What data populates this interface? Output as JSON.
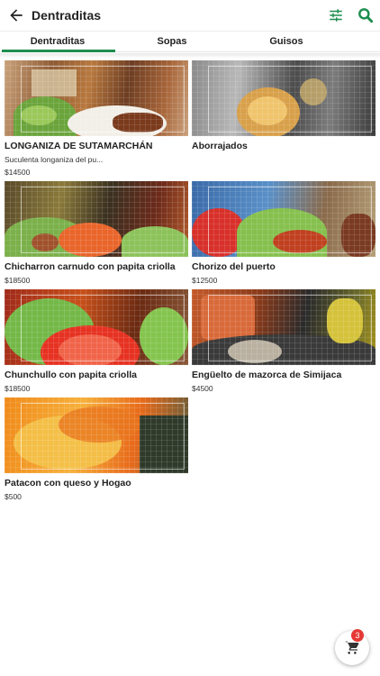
{
  "appbar": {
    "title": "Dentraditas"
  },
  "tabs": [
    {
      "label": "Dentraditas",
      "active": true
    },
    {
      "label": "Sopas",
      "active": false
    },
    {
      "label": "Guisos",
      "active": false
    }
  ],
  "colors": {
    "accent": "#1e8e4e",
    "badge": "#e53935"
  },
  "icons": {
    "back": "arrow-back-icon",
    "filter": "tune-icon",
    "search": "search-icon",
    "cart": "cart-icon"
  },
  "products": [
    {
      "name": "LONGANIZA DE SUTAMARCHÁN",
      "description": "Suculenta longaniza del pu...",
      "price": "$14500"
    },
    {
      "name": "Aborrajados",
      "description": "",
      "price": ""
    },
    {
      "name": "Chicharron carnudo con papita criolla",
      "description": "",
      "price": "$18500"
    },
    {
      "name": "Chorizo del puerto",
      "description": "",
      "price": "$12500"
    },
    {
      "name": "Chunchullo con papita criolla",
      "description": "",
      "price": "$18500"
    },
    {
      "name": "Engüelto de mazorca de Simijaca",
      "description": "",
      "price": "$4500"
    },
    {
      "name": "Patacon con queso y Hogao",
      "description": "",
      "price": "$500"
    }
  ],
  "cart": {
    "count": "3"
  }
}
